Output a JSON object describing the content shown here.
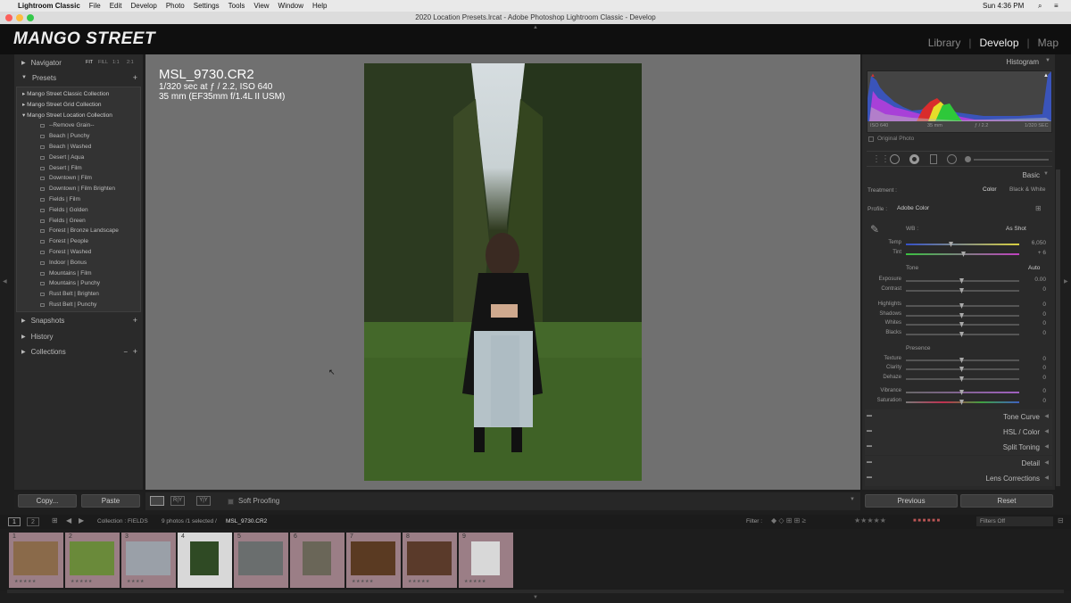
{
  "menubar": {
    "app": "Lightroom Classic",
    "items": [
      "File",
      "Edit",
      "Develop",
      "Photo",
      "Settings",
      "Tools",
      "View",
      "Window",
      "Help"
    ],
    "clock": "Sun 4:36 PM"
  },
  "window_title": "2020 Location Presets.lrcat - Adobe Photoshop Lightroom Classic - Develop",
  "logo": "MANGO STREET",
  "modules": [
    "Library",
    "Develop",
    "Map"
  ],
  "left": {
    "navigator": "Navigator",
    "nav_zooms": [
      "FIT",
      "FILL",
      "1:1",
      "2:1"
    ],
    "presets": "Presets",
    "collections_tree": [
      {
        "name": "Mango Street Classic Collection",
        "open": false
      },
      {
        "name": "Mango Street Grid Collection",
        "open": false
      },
      {
        "name": "Mango Street Location Collection",
        "open": true
      }
    ],
    "preset_items": [
      "--Remove Grain--",
      "Beach | Punchy",
      "Beach | Washed",
      "Desert | Aqua",
      "Desert | Film",
      "Downtown | Film",
      "Downtown | Film Brighten",
      "Fields | Film",
      "Fields | Golden",
      "Fields | Green",
      "Forest | Bronze Landscape",
      "Forest | People",
      "Forest | Washed",
      "Indoor | Bonus",
      "Mountains | Film",
      "Mountains | Punchy",
      "Rust Belt | Brighten",
      "Rust Belt | Punchy"
    ],
    "snapshots": "Snapshots",
    "history": "History",
    "collections": "Collections",
    "copy_btn": "Copy...",
    "paste_btn": "Paste"
  },
  "info": {
    "filename": "MSL_9730.CR2",
    "exposure_fraction": "1/320",
    "exposure_rest": " sec at ƒ / 2.2, ISO 640",
    "lens": "35 mm (EF35mm f/1.4L II USM)"
  },
  "toolbar": {
    "soft_proofing": "Soft Proofing"
  },
  "right": {
    "histogram": "Histogram",
    "histo_meta": [
      "ISO 640",
      "35 mm",
      "ƒ / 2.2",
      "1/320 SEC"
    ],
    "original_photo": "Original Photo",
    "basic": "Basic",
    "treatment_label": "Treatment :",
    "treatment_color": "Color",
    "treatment_bw": "Black & White",
    "profile_label": "Profile :",
    "profile_value": "Adobe Color",
    "wb_label": "WB :",
    "wb_value": "As Shot",
    "temp": {
      "label": "Temp",
      "value": "6,050"
    },
    "tint": {
      "label": "Tint",
      "value": "+ 6"
    },
    "tone": "Tone",
    "auto": "Auto",
    "tone_sliders": [
      {
        "label": "Exposure",
        "value": "0.00"
      },
      {
        "label": "Contrast",
        "value": "0"
      },
      {
        "label": "Highlights",
        "value": "0"
      },
      {
        "label": "Shadows",
        "value": "0"
      },
      {
        "label": "Whites",
        "value": "0"
      },
      {
        "label": "Blacks",
        "value": "0"
      }
    ],
    "presence": "Presence",
    "presence_sliders": [
      {
        "label": "Texture",
        "value": "0"
      },
      {
        "label": "Clarity",
        "value": "0"
      },
      {
        "label": "Dehaze",
        "value": "0"
      },
      {
        "label": "Vibrance",
        "value": "0"
      },
      {
        "label": "Saturation",
        "value": "0"
      }
    ],
    "sections": [
      "Tone Curve",
      "HSL / Color",
      "Split Toning",
      "Detail",
      "Lens Corrections"
    ],
    "previous_btn": "Previous",
    "reset_btn": "Reset"
  },
  "filmbar": {
    "page1": "1",
    "page2": "2",
    "collection": "Collection : FIELDS",
    "count": "9 photos /1 selected /",
    "selected_file": "MSL_9730.CR2",
    "filter": "Filter :",
    "filters_off": "Filters Off"
  },
  "thumbs": [
    {
      "n": "1",
      "stars": "★★★★★",
      "color": "#8a6a4a"
    },
    {
      "n": "2",
      "stars": "★★★★★",
      "color": "#6a8a3a"
    },
    {
      "n": "3",
      "stars": "★★★★",
      "color": "#9aa0a8"
    },
    {
      "n": "4",
      "stars": "",
      "color": "#2f4a24"
    },
    {
      "n": "5",
      "stars": "",
      "color": "#6a6e6e"
    },
    {
      "n": "6",
      "stars": "",
      "color": "#6a6658"
    },
    {
      "n": "7",
      "stars": "★★★★★",
      "color": "#5a3a22"
    },
    {
      "n": "8",
      "stars": "★★★★★",
      "color": "#5a3a2a"
    },
    {
      "n": "9",
      "stars": "★★★★★",
      "color": "#d8d8d8"
    }
  ]
}
